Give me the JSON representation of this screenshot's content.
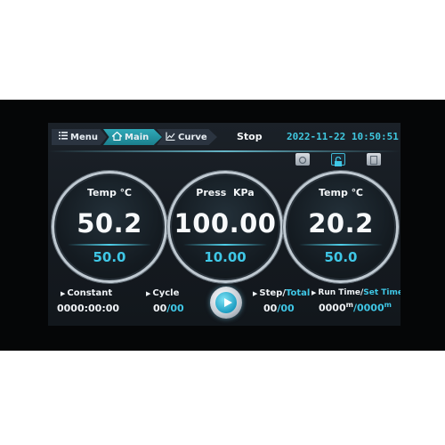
{
  "header": {
    "tabs": [
      {
        "label": "Menu",
        "icon": "list-icon"
      },
      {
        "label": "Main",
        "icon": "home-icon",
        "active": true
      },
      {
        "label": "Curve",
        "icon": "chart-icon"
      }
    ],
    "status": "Stop",
    "datetime": "2022-11-22 10:50:51"
  },
  "toolbar": {
    "icons": [
      "settings-icon",
      "lock-icon",
      "document-icon"
    ]
  },
  "gauges": [
    {
      "title": "Temp ℃",
      "pv": "50.2",
      "sv": "50.0"
    },
    {
      "title": "Press  KPa",
      "pv": "100.00",
      "sv": "10.00"
    },
    {
      "title": "Temp ℃",
      "pv": "20.2",
      "sv": "50.0"
    }
  ],
  "footer": {
    "constant_label": "Constant",
    "constant_value": "0000:00:00",
    "cycle_label": "Cycle",
    "cycle_value_a": "00",
    "cycle_value_b": "/00",
    "step_label": "Step/",
    "total_label": "Total",
    "step_value_a": "00",
    "step_value_b": "/00",
    "runtime_label": "Run Time/",
    "settime_label": "Set Time",
    "runtime_value_a": "0000",
    "runtime_unit_a": "m",
    "runtime_value_b": "/0000",
    "runtime_unit_b": "m"
  },
  "colors": {
    "accent": "#3fc7e6",
    "active_tab": "#1b7f8d",
    "background": "#151a20"
  }
}
